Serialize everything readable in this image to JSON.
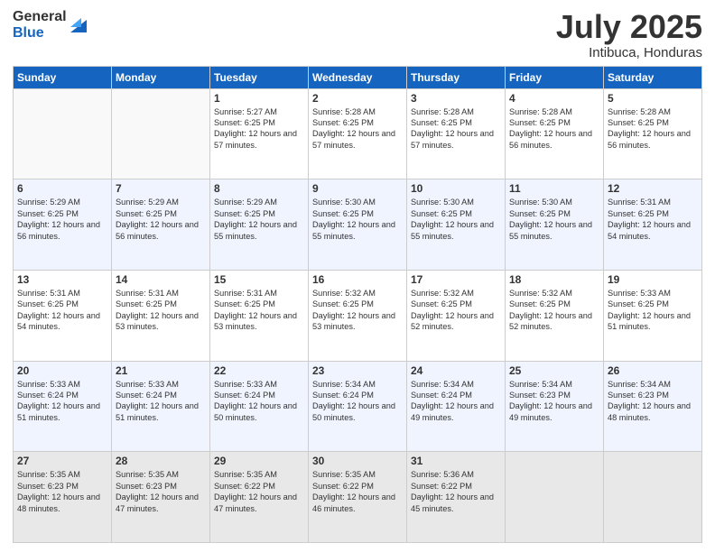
{
  "logo": {
    "general": "General",
    "blue": "Blue"
  },
  "calendar": {
    "title": "July 2025",
    "subtitle": "Intibuca, Honduras"
  },
  "days_of_week": [
    "Sunday",
    "Monday",
    "Tuesday",
    "Wednesday",
    "Thursday",
    "Friday",
    "Saturday"
  ],
  "weeks": [
    [
      {
        "day": null
      },
      {
        "day": null
      },
      {
        "day": "1",
        "sunrise": "Sunrise: 5:27 AM",
        "sunset": "Sunset: 6:25 PM",
        "daylight": "Daylight: 12 hours and 57 minutes."
      },
      {
        "day": "2",
        "sunrise": "Sunrise: 5:28 AM",
        "sunset": "Sunset: 6:25 PM",
        "daylight": "Daylight: 12 hours and 57 minutes."
      },
      {
        "day": "3",
        "sunrise": "Sunrise: 5:28 AM",
        "sunset": "Sunset: 6:25 PM",
        "daylight": "Daylight: 12 hours and 57 minutes."
      },
      {
        "day": "4",
        "sunrise": "Sunrise: 5:28 AM",
        "sunset": "Sunset: 6:25 PM",
        "daylight": "Daylight: 12 hours and 56 minutes."
      },
      {
        "day": "5",
        "sunrise": "Sunrise: 5:28 AM",
        "sunset": "Sunset: 6:25 PM",
        "daylight": "Daylight: 12 hours and 56 minutes."
      }
    ],
    [
      {
        "day": "6",
        "sunrise": "Sunrise: 5:29 AM",
        "sunset": "Sunset: 6:25 PM",
        "daylight": "Daylight: 12 hours and 56 minutes."
      },
      {
        "day": "7",
        "sunrise": "Sunrise: 5:29 AM",
        "sunset": "Sunset: 6:25 PM",
        "daylight": "Daylight: 12 hours and 56 minutes."
      },
      {
        "day": "8",
        "sunrise": "Sunrise: 5:29 AM",
        "sunset": "Sunset: 6:25 PM",
        "daylight": "Daylight: 12 hours and 55 minutes."
      },
      {
        "day": "9",
        "sunrise": "Sunrise: 5:30 AM",
        "sunset": "Sunset: 6:25 PM",
        "daylight": "Daylight: 12 hours and 55 minutes."
      },
      {
        "day": "10",
        "sunrise": "Sunrise: 5:30 AM",
        "sunset": "Sunset: 6:25 PM",
        "daylight": "Daylight: 12 hours and 55 minutes."
      },
      {
        "day": "11",
        "sunrise": "Sunrise: 5:30 AM",
        "sunset": "Sunset: 6:25 PM",
        "daylight": "Daylight: 12 hours and 55 minutes."
      },
      {
        "day": "12",
        "sunrise": "Sunrise: 5:31 AM",
        "sunset": "Sunset: 6:25 PM",
        "daylight": "Daylight: 12 hours and 54 minutes."
      }
    ],
    [
      {
        "day": "13",
        "sunrise": "Sunrise: 5:31 AM",
        "sunset": "Sunset: 6:25 PM",
        "daylight": "Daylight: 12 hours and 54 minutes."
      },
      {
        "day": "14",
        "sunrise": "Sunrise: 5:31 AM",
        "sunset": "Sunset: 6:25 PM",
        "daylight": "Daylight: 12 hours and 53 minutes."
      },
      {
        "day": "15",
        "sunrise": "Sunrise: 5:31 AM",
        "sunset": "Sunset: 6:25 PM",
        "daylight": "Daylight: 12 hours and 53 minutes."
      },
      {
        "day": "16",
        "sunrise": "Sunrise: 5:32 AM",
        "sunset": "Sunset: 6:25 PM",
        "daylight": "Daylight: 12 hours and 53 minutes."
      },
      {
        "day": "17",
        "sunrise": "Sunrise: 5:32 AM",
        "sunset": "Sunset: 6:25 PM",
        "daylight": "Daylight: 12 hours and 52 minutes."
      },
      {
        "day": "18",
        "sunrise": "Sunrise: 5:32 AM",
        "sunset": "Sunset: 6:25 PM",
        "daylight": "Daylight: 12 hours and 52 minutes."
      },
      {
        "day": "19",
        "sunrise": "Sunrise: 5:33 AM",
        "sunset": "Sunset: 6:25 PM",
        "daylight": "Daylight: 12 hours and 51 minutes."
      }
    ],
    [
      {
        "day": "20",
        "sunrise": "Sunrise: 5:33 AM",
        "sunset": "Sunset: 6:24 PM",
        "daylight": "Daylight: 12 hours and 51 minutes."
      },
      {
        "day": "21",
        "sunrise": "Sunrise: 5:33 AM",
        "sunset": "Sunset: 6:24 PM",
        "daylight": "Daylight: 12 hours and 51 minutes."
      },
      {
        "day": "22",
        "sunrise": "Sunrise: 5:33 AM",
        "sunset": "Sunset: 6:24 PM",
        "daylight": "Daylight: 12 hours and 50 minutes."
      },
      {
        "day": "23",
        "sunrise": "Sunrise: 5:34 AM",
        "sunset": "Sunset: 6:24 PM",
        "daylight": "Daylight: 12 hours and 50 minutes."
      },
      {
        "day": "24",
        "sunrise": "Sunrise: 5:34 AM",
        "sunset": "Sunset: 6:24 PM",
        "daylight": "Daylight: 12 hours and 49 minutes."
      },
      {
        "day": "25",
        "sunrise": "Sunrise: 5:34 AM",
        "sunset": "Sunset: 6:23 PM",
        "daylight": "Daylight: 12 hours and 49 minutes."
      },
      {
        "day": "26",
        "sunrise": "Sunrise: 5:34 AM",
        "sunset": "Sunset: 6:23 PM",
        "daylight": "Daylight: 12 hours and 48 minutes."
      }
    ],
    [
      {
        "day": "27",
        "sunrise": "Sunrise: 5:35 AM",
        "sunset": "Sunset: 6:23 PM",
        "daylight": "Daylight: 12 hours and 48 minutes."
      },
      {
        "day": "28",
        "sunrise": "Sunrise: 5:35 AM",
        "sunset": "Sunset: 6:23 PM",
        "daylight": "Daylight: 12 hours and 47 minutes."
      },
      {
        "day": "29",
        "sunrise": "Sunrise: 5:35 AM",
        "sunset": "Sunset: 6:22 PM",
        "daylight": "Daylight: 12 hours and 47 minutes."
      },
      {
        "day": "30",
        "sunrise": "Sunrise: 5:35 AM",
        "sunset": "Sunset: 6:22 PM",
        "daylight": "Daylight: 12 hours and 46 minutes."
      },
      {
        "day": "31",
        "sunrise": "Sunrise: 5:36 AM",
        "sunset": "Sunset: 6:22 PM",
        "daylight": "Daylight: 12 hours and 45 minutes."
      },
      {
        "day": null
      },
      {
        "day": null
      }
    ]
  ]
}
